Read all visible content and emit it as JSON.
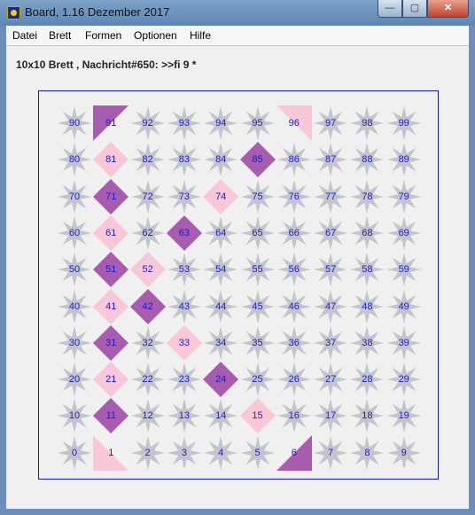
{
  "window": {
    "title": "Board, 1.16 Dezember 2017",
    "minimize": "—",
    "maximize": "▢",
    "close": "✕"
  },
  "menu": [
    "Datei",
    "Brett",
    "Formen",
    "Optionen",
    "Hilfe"
  ],
  "status": "10x10 Brett , Nachricht#650: >>fi 9 *",
  "colors": {
    "number": "#1a1ad0",
    "star": "#c4c4cc",
    "purple": "#a85cb0",
    "pink": "#f8c8d8",
    "frame": "#1a1aa0"
  },
  "board": {
    "cols": 10,
    "rows": 10,
    "cells": [
      {
        "n": "0",
        "shape": "star"
      },
      {
        "n": "1",
        "shape": "triangle-bl",
        "color": "pink"
      },
      {
        "n": "2",
        "shape": "star"
      },
      {
        "n": "3",
        "shape": "star"
      },
      {
        "n": "4",
        "shape": "star"
      },
      {
        "n": "5",
        "shape": "star"
      },
      {
        "n": "6",
        "shape": "triangle-br",
        "color": "purple"
      },
      {
        "n": "7",
        "shape": "star"
      },
      {
        "n": "8",
        "shape": "star"
      },
      {
        "n": "9",
        "shape": "star"
      },
      {
        "n": "10",
        "shape": "star"
      },
      {
        "n": "11",
        "shape": "diamond",
        "color": "purple"
      },
      {
        "n": "12",
        "shape": "star"
      },
      {
        "n": "13",
        "shape": "star"
      },
      {
        "n": "14",
        "shape": "star"
      },
      {
        "n": "15",
        "shape": "diamond",
        "color": "pink"
      },
      {
        "n": "16",
        "shape": "star"
      },
      {
        "n": "17",
        "shape": "star"
      },
      {
        "n": "18",
        "shape": "star"
      },
      {
        "n": "19",
        "shape": "star"
      },
      {
        "n": "20",
        "shape": "star"
      },
      {
        "n": "21",
        "shape": "diamond",
        "color": "pink"
      },
      {
        "n": "22",
        "shape": "star"
      },
      {
        "n": "23",
        "shape": "star"
      },
      {
        "n": "24",
        "shape": "diamond",
        "color": "purple"
      },
      {
        "n": "25",
        "shape": "star"
      },
      {
        "n": "26",
        "shape": "star"
      },
      {
        "n": "27",
        "shape": "star"
      },
      {
        "n": "28",
        "shape": "star"
      },
      {
        "n": "29",
        "shape": "star"
      },
      {
        "n": "30",
        "shape": "star"
      },
      {
        "n": "31",
        "shape": "diamond",
        "color": "purple"
      },
      {
        "n": "32",
        "shape": "star"
      },
      {
        "n": "33",
        "shape": "diamond",
        "color": "pink"
      },
      {
        "n": "34",
        "shape": "star"
      },
      {
        "n": "35",
        "shape": "star"
      },
      {
        "n": "36",
        "shape": "star"
      },
      {
        "n": "37",
        "shape": "star"
      },
      {
        "n": "38",
        "shape": "star"
      },
      {
        "n": "39",
        "shape": "star"
      },
      {
        "n": "40",
        "shape": "star"
      },
      {
        "n": "41",
        "shape": "diamond",
        "color": "pink"
      },
      {
        "n": "42",
        "shape": "diamond",
        "color": "purple"
      },
      {
        "n": "43",
        "shape": "star"
      },
      {
        "n": "44",
        "shape": "star"
      },
      {
        "n": "45",
        "shape": "star"
      },
      {
        "n": "46",
        "shape": "star"
      },
      {
        "n": "47",
        "shape": "star"
      },
      {
        "n": "48",
        "shape": "star"
      },
      {
        "n": "49",
        "shape": "star"
      },
      {
        "n": "50",
        "shape": "star"
      },
      {
        "n": "51",
        "shape": "diamond",
        "color": "purple"
      },
      {
        "n": "52",
        "shape": "diamond",
        "color": "pink"
      },
      {
        "n": "53",
        "shape": "star"
      },
      {
        "n": "54",
        "shape": "star"
      },
      {
        "n": "55",
        "shape": "star"
      },
      {
        "n": "56",
        "shape": "star"
      },
      {
        "n": "57",
        "shape": "star"
      },
      {
        "n": "58",
        "shape": "star"
      },
      {
        "n": "59",
        "shape": "star"
      },
      {
        "n": "60",
        "shape": "star"
      },
      {
        "n": "61",
        "shape": "diamond",
        "color": "pink"
      },
      {
        "n": "62",
        "shape": "star"
      },
      {
        "n": "63",
        "shape": "diamond",
        "color": "purple"
      },
      {
        "n": "64",
        "shape": "star"
      },
      {
        "n": "65",
        "shape": "star"
      },
      {
        "n": "66",
        "shape": "star"
      },
      {
        "n": "67",
        "shape": "star"
      },
      {
        "n": "68",
        "shape": "star"
      },
      {
        "n": "69",
        "shape": "star"
      },
      {
        "n": "70",
        "shape": "star"
      },
      {
        "n": "71",
        "shape": "diamond",
        "color": "purple"
      },
      {
        "n": "72",
        "shape": "star"
      },
      {
        "n": "73",
        "shape": "star"
      },
      {
        "n": "74",
        "shape": "diamond",
        "color": "pink"
      },
      {
        "n": "75",
        "shape": "star"
      },
      {
        "n": "76",
        "shape": "star"
      },
      {
        "n": "77",
        "shape": "star"
      },
      {
        "n": "78",
        "shape": "star"
      },
      {
        "n": "79",
        "shape": "star"
      },
      {
        "n": "80",
        "shape": "star"
      },
      {
        "n": "81",
        "shape": "diamond",
        "color": "pink"
      },
      {
        "n": "82",
        "shape": "star"
      },
      {
        "n": "83",
        "shape": "star"
      },
      {
        "n": "84",
        "shape": "star"
      },
      {
        "n": "85",
        "shape": "diamond",
        "color": "purple"
      },
      {
        "n": "86",
        "shape": "star"
      },
      {
        "n": "87",
        "shape": "star"
      },
      {
        "n": "88",
        "shape": "star"
      },
      {
        "n": "89",
        "shape": "star"
      },
      {
        "n": "90",
        "shape": "star"
      },
      {
        "n": "91",
        "shape": "triangle-tl",
        "color": "purple"
      },
      {
        "n": "92",
        "shape": "star"
      },
      {
        "n": "93",
        "shape": "star"
      },
      {
        "n": "94",
        "shape": "star"
      },
      {
        "n": "95",
        "shape": "star"
      },
      {
        "n": "96",
        "shape": "triangle-tr",
        "color": "pink"
      },
      {
        "n": "97",
        "shape": "star"
      },
      {
        "n": "98",
        "shape": "star"
      },
      {
        "n": "99",
        "shape": "star"
      }
    ]
  }
}
